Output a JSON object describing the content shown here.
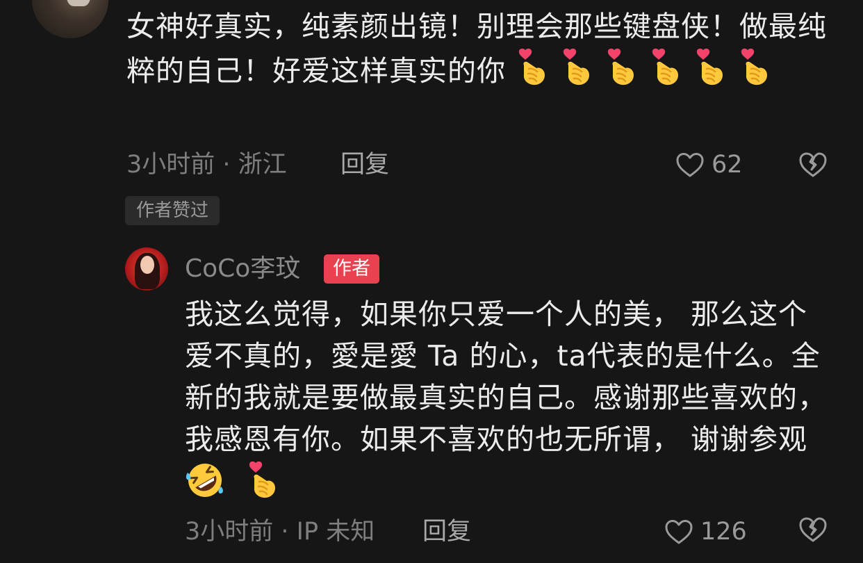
{
  "comment": {
    "text": "女神好真实，纯素颜出镜！别理会那些键盘侠！做最纯粹的自己！好爱这样真实的你 ",
    "emoji_name": "heart-hands-emoji",
    "emoji_count": 6,
    "time": "3小时前",
    "location_sep": " · ",
    "location": "浙江",
    "reply_label": "回复",
    "likes": "62",
    "author_liked_label": "作者赞过"
  },
  "reply": {
    "author_name": "CoCo李玟",
    "author_badge": "作者",
    "text": "我这么觉得，如果你只爱一个人的美， 那么这个爱不真的，愛是愛 Ta 的心，ta代表的是什么。全新的我就是要做最真实的自己。感谢那些喜欢的，我感恩有你。如果不喜欢的也无所谓， 谢谢参观",
    "emojis": [
      "rofl-emoji",
      "heart-hands-emoji"
    ],
    "time": "3小时前",
    "location_sep": " · ",
    "location": "IP 未知",
    "reply_label": "回复",
    "likes": "126"
  },
  "colors": {
    "background": "#161616",
    "text_primary": "#ececec",
    "text_secondary": "#7e7e7e",
    "badge_red": "#e8414f",
    "chip_bg": "#2b2b2b"
  }
}
